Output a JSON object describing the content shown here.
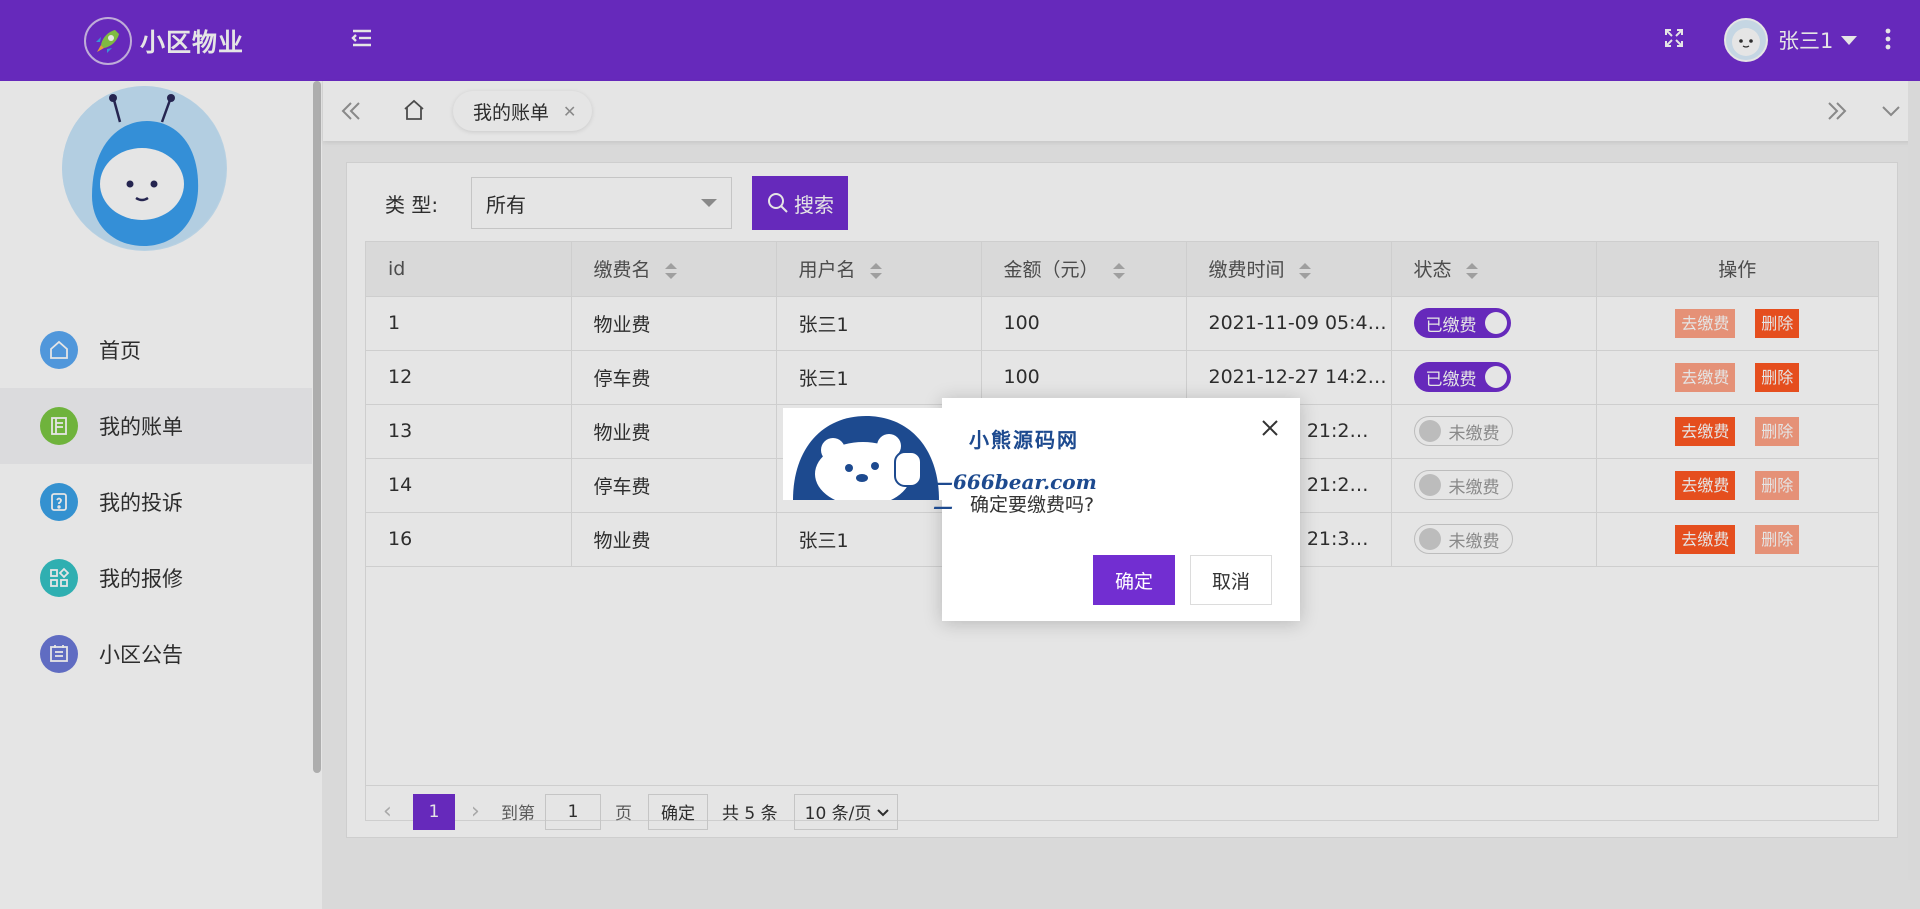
{
  "app": {
    "title": "小区物业",
    "brand_color": "#722ed1"
  },
  "user": {
    "name": "张三1"
  },
  "sidebar": {
    "items": [
      {
        "label": "首页",
        "icon": "home-icon",
        "color": "#5aa9f4"
      },
      {
        "label": "我的账单",
        "icon": "bill-icon",
        "color": "#7cc843"
      },
      {
        "label": "我的投诉",
        "icon": "complaint-icon",
        "color": "#3aa2e8"
      },
      {
        "label": "我的报修",
        "icon": "repair-icon",
        "color": "#35c3c6"
      },
      {
        "label": "小区公告",
        "icon": "notice-icon",
        "color": "#6b79d8"
      }
    ],
    "active_index": 1
  },
  "tabs": {
    "items": [
      {
        "label": "我的账单"
      }
    ]
  },
  "filter": {
    "label": "类 型:",
    "selected": "所有",
    "search_label": "搜索"
  },
  "table": {
    "headers": [
      "id",
      "缴费名",
      "用户名",
      "金额（元）",
      "缴费时间",
      "状态",
      "操作"
    ],
    "rows": [
      {
        "id": "1",
        "name": "物业费",
        "user": "张三1",
        "amount": "100",
        "time": "2021-11-09 05:4…",
        "status": "已缴费",
        "paid": true
      },
      {
        "id": "12",
        "name": "停车费",
        "user": "张三1",
        "amount": "100",
        "time": "2021-12-27 14:2…",
        "status": "已缴费",
        "paid": true
      },
      {
        "id": "13",
        "name": "物业费",
        "user": "",
        "amount": "",
        "time": "7 21:2…",
        "status": "未缴费",
        "paid": false
      },
      {
        "id": "14",
        "name": "停车费",
        "user": "",
        "amount": "",
        "time": "7 21:2…",
        "status": "未缴费",
        "paid": false
      },
      {
        "id": "16",
        "name": "物业费",
        "user": "张三1",
        "amount": "",
        "time": "7 21:3…",
        "status": "未缴费",
        "paid": false
      }
    ],
    "pay_label": "去缴费",
    "delete_label": "删除"
  },
  "pager": {
    "current": "1",
    "goto_label": "到第",
    "goto_value": "1",
    "page_unit": "页",
    "confirm_label": "确定",
    "total": "共 5 条",
    "page_size": "10 条/页"
  },
  "dialog": {
    "message": "确定要缴费吗?",
    "ok_label": "确定",
    "cancel_label": "取消"
  },
  "watermark": {
    "line1": "小熊源码网",
    "line2": "—666bear.com—"
  }
}
